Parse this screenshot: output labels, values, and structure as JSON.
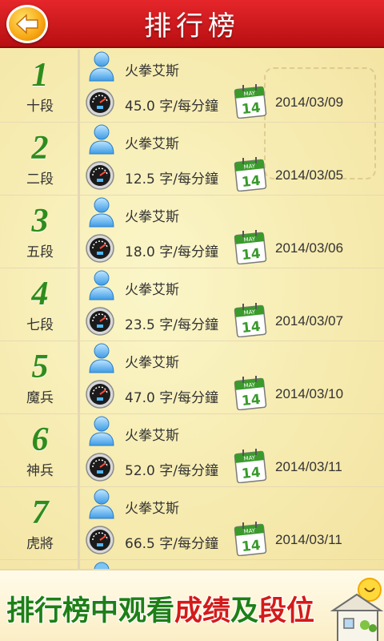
{
  "header": {
    "title": "排行榜",
    "back_icon": "back-arrow-icon"
  },
  "rows": [
    {
      "rank": "1",
      "level": "十段",
      "name": "火拳艾斯",
      "speed": "45.0 字/每分鐘",
      "date": "2014/03/09",
      "calendar_month": "MAY",
      "calendar_day": "14"
    },
    {
      "rank": "2",
      "level": "二段",
      "name": "火拳艾斯",
      "speed": "12.5 字/每分鐘",
      "date": "2014/03/05",
      "calendar_month": "MAY",
      "calendar_day": "14"
    },
    {
      "rank": "3",
      "level": "五段",
      "name": "火拳艾斯",
      "speed": "18.0 字/每分鐘",
      "date": "2014/03/06",
      "calendar_month": "MAY",
      "calendar_day": "14"
    },
    {
      "rank": "4",
      "level": "七段",
      "name": "火拳艾斯",
      "speed": "23.5 字/每分鐘",
      "date": "2014/03/07",
      "calendar_month": "MAY",
      "calendar_day": "14"
    },
    {
      "rank": "5",
      "level": "魔兵",
      "name": "火拳艾斯",
      "speed": "47.0 字/每分鐘",
      "date": "2014/03/10",
      "calendar_month": "MAY",
      "calendar_day": "14"
    },
    {
      "rank": "6",
      "level": "神兵",
      "name": "火拳艾斯",
      "speed": "52.0 字/每分鐘",
      "date": "2014/03/11",
      "calendar_month": "MAY",
      "calendar_day": "14"
    },
    {
      "rank": "7",
      "level": "虎將",
      "name": "火拳艾斯",
      "speed": "66.5 字/每分鐘",
      "date": "2014/03/11",
      "calendar_month": "MAY",
      "calendar_day": "14"
    }
  ],
  "banner": {
    "part1": "排行榜中观看",
    "part2": "成绩",
    "part3": "及",
    "part4": "段位"
  },
  "colors": {
    "header_red": "#d01a1e",
    "rank_green": "#2e8c1d",
    "banner_red": "#d41a1a",
    "banner_green": "#1e7f16"
  }
}
